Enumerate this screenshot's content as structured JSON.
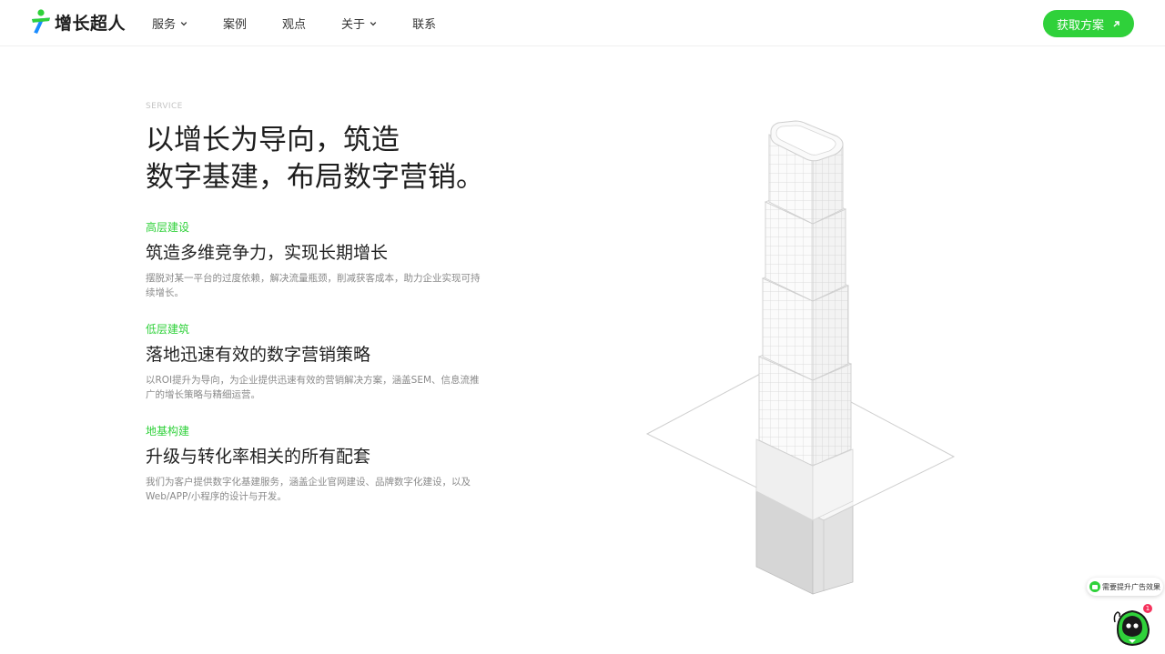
{
  "brand": {
    "name": "增长超人"
  },
  "nav": {
    "items": [
      {
        "label": "服务",
        "has_dropdown": true
      },
      {
        "label": "案例",
        "has_dropdown": false
      },
      {
        "label": "观点",
        "has_dropdown": false
      },
      {
        "label": "关于",
        "has_dropdown": true
      },
      {
        "label": "联系",
        "has_dropdown": false
      }
    ],
    "cta_label": "获取方案"
  },
  "hero": {
    "eyebrow": "SERVICE",
    "title_line1": "以增长为导向，筑造",
    "title_line2": "数字基建，布局数字营销。"
  },
  "features": [
    {
      "tag": "高层建设",
      "title": "筑造多维竞争力，实现长期增长",
      "description": "摆脱对某一平台的过度依赖，解决流量瓶颈，削减获客成本，助力企业实现可持续增长。"
    },
    {
      "tag": "低层建筑",
      "title": "落地迅速有效的数字营销策略",
      "description": "以ROI提升为导向，为企业提供迅速有效的营销解决方案，涵盖SEM、信息流推广的增长策略与精细运营。"
    },
    {
      "tag": "地基构建",
      "title": "升级与转化率相关的所有配套",
      "description": "我们为客户提供数字化基建服务，涵盖企业官网建设、品牌数字化建设，以及Web/APP/小程序的设计与开发。"
    }
  ],
  "widgets": {
    "ad_pill_label": "需要提升广告效果",
    "notification_count": "1"
  },
  "colors": {
    "accent": "#2fd13a",
    "text_primary": "#1e1e1e",
    "text_muted": "#8a8a8a",
    "badge": "#f5325c"
  },
  "icons": {
    "logo": "growth-person-logo",
    "dropdown": "chevron-down-icon",
    "cta": "arrow-up-right-icon",
    "chat": "chat-bubble-icon",
    "assistant": "robot-assistant-icon"
  }
}
